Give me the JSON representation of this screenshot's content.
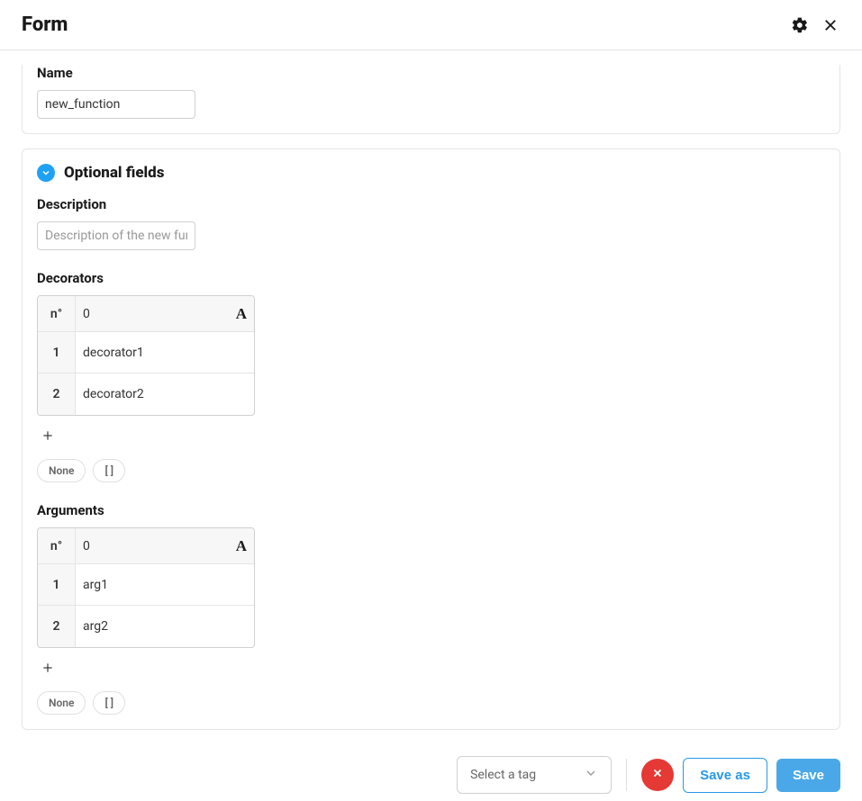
{
  "header": {
    "title": "Form"
  },
  "name_section": {
    "label": "Name",
    "value": "new_function"
  },
  "optional_fields": {
    "title": "Optional fields",
    "description": {
      "label": "Description",
      "placeholder": "Description of the new func"
    },
    "decorators": {
      "label": "Decorators",
      "row_header": "n°",
      "col_header": "0",
      "rows": [
        {
          "n": "1",
          "value": "decorator1"
        },
        {
          "n": "2",
          "value": "decorator2"
        }
      ],
      "pill_none": "None",
      "pill_brackets": "[ ]"
    },
    "arguments": {
      "label": "Arguments",
      "row_header": "n°",
      "col_header": "0",
      "rows": [
        {
          "n": "1",
          "value": "arg1"
        },
        {
          "n": "2",
          "value": "arg2"
        }
      ],
      "pill_none": "None",
      "pill_brackets": "[ ]"
    }
  },
  "footer": {
    "tag_select_placeholder": "Select a tag",
    "save_as_label": "Save as",
    "save_label": "Save"
  }
}
